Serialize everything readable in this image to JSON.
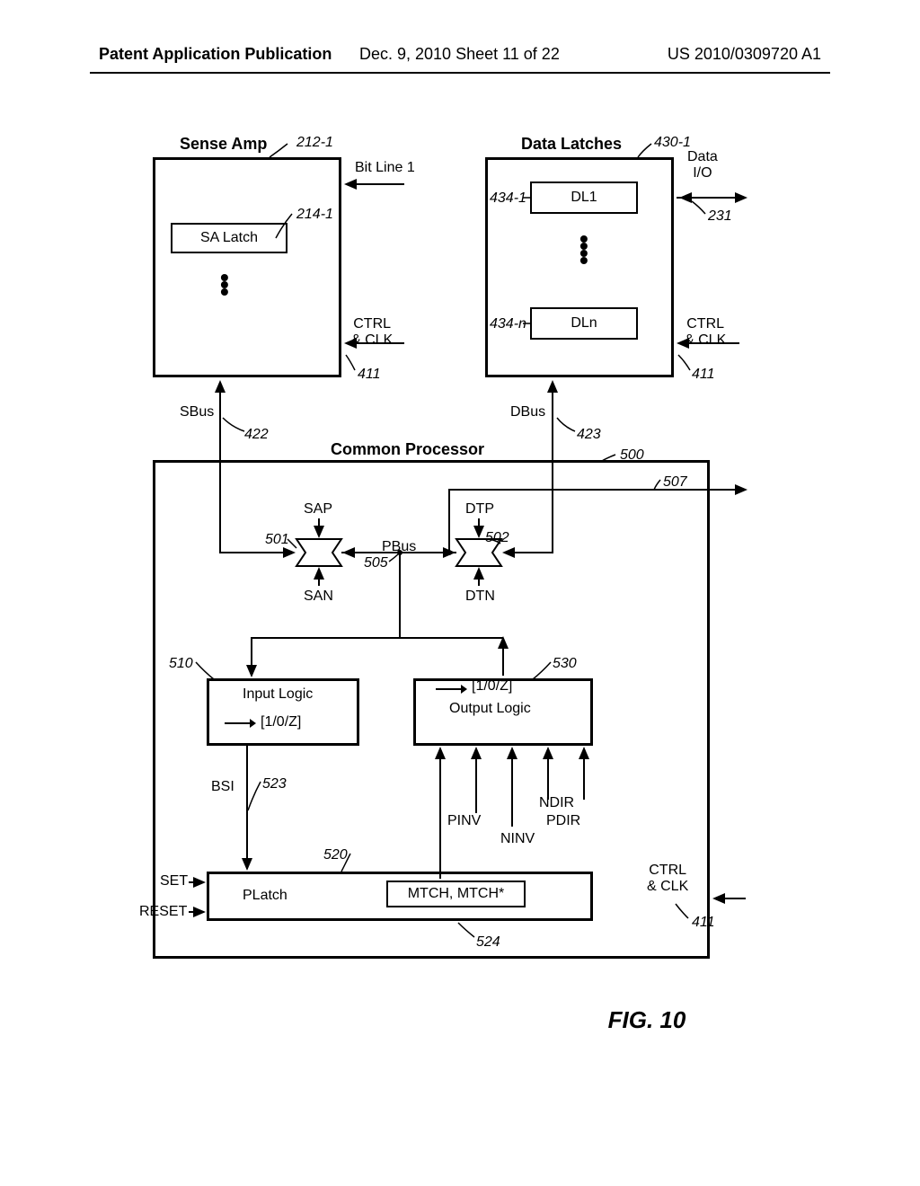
{
  "header": {
    "left": "Patent Application Publication",
    "mid": "Dec. 9, 2010   Sheet 11 of 22",
    "right": "US 2010/0309720 A1"
  },
  "senseAmp": {
    "title": "Sense Amp",
    "ref": "212-1",
    "latch": "SA Latch",
    "latchRef": "214-1",
    "bitline": "Bit Line 1",
    "ctrl": "CTRL\n& CLK",
    "ctrlRef": "411",
    "bus": "SBus",
    "busRef": "422"
  },
  "dataLatches": {
    "title": "Data Latches",
    "ref": "430-1",
    "dl1": "DL1",
    "dl1Ref": "434-1",
    "dln": "DLn",
    "dlnRef": "434-n",
    "io": "Data\nI/O",
    "ioRef": "231",
    "ctrl": "CTRL\n& CLK",
    "ctrlRef": "411",
    "bus": "DBus",
    "busRef": "423"
  },
  "processor": {
    "title": "Common Processor",
    "ref": "500",
    "outRef": "507",
    "sap": "SAP",
    "san": "SAN",
    "dtp": "DTP",
    "dtn": "DTN",
    "gate1Ref": "501",
    "gate2Ref": "502",
    "pbus": "PBus",
    "pbusRef": "505",
    "inputLogic": "Input Logic",
    "inputLogicSig": "[1/0/Z]",
    "inputRef": "510",
    "outputLogic": "Output Logic",
    "outputLogicSig": "[1/0/Z]",
    "outputRef": "530",
    "bsi": "BSI",
    "bsiRef": "523",
    "platch": "PLatch",
    "platchRef": "520",
    "mtch": "MTCH, MTCH*",
    "mtchRef": "524",
    "set": "SET",
    "reset": "RESET",
    "pinv": "PINV",
    "ninv": "NINV",
    "pdir": "PDIR",
    "ndir": "NDIR",
    "ctrl": "CTRL\n& CLK",
    "ctrlRef": "411"
  },
  "figTitle": "FIG. 10"
}
